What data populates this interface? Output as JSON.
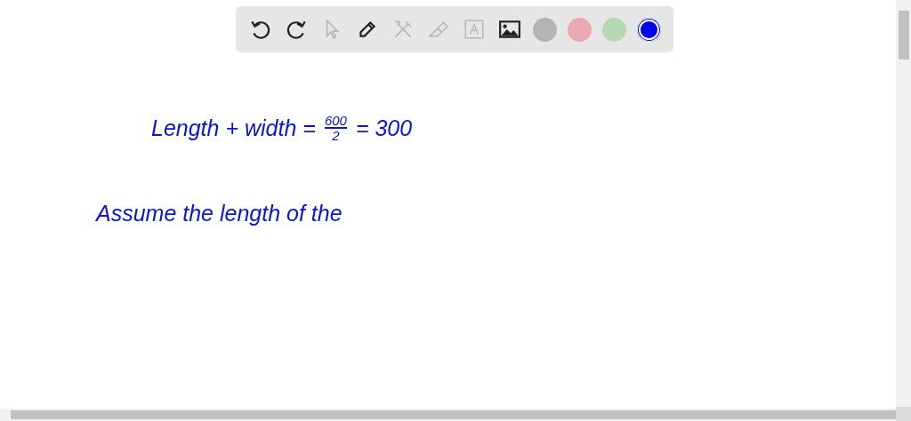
{
  "toolbar": {
    "items": [
      {
        "kind": "tool",
        "disabled": false
      },
      {
        "kind": "tool",
        "disabled": false
      },
      {
        "kind": "tool",
        "disabled": true
      },
      {
        "kind": "tool",
        "disabled": false
      },
      {
        "kind": "tool",
        "disabled": true
      },
      {
        "kind": "tool",
        "disabled": true
      },
      {
        "kind": "tool",
        "disabled": true
      },
      {
        "kind": "tool",
        "disabled": false
      },
      {
        "kind": "color",
        "color": "#b3b3b3",
        "selected": false
      },
      {
        "kind": "color",
        "color": "#e8a9b1",
        "selected": false
      },
      {
        "kind": "color",
        "color": "#b6d8b4",
        "selected": false
      },
      {
        "kind": "color",
        "color": "#0000ee",
        "selected": true
      }
    ]
  },
  "canvas": {
    "notes": [
      {
        "kind": "equation",
        "left": "Length + width =",
        "numerator": "600",
        "denominator": "2",
        "right": "= 300"
      },
      {
        "kind": "line",
        "text": "Assume the length of the"
      }
    ]
  }
}
